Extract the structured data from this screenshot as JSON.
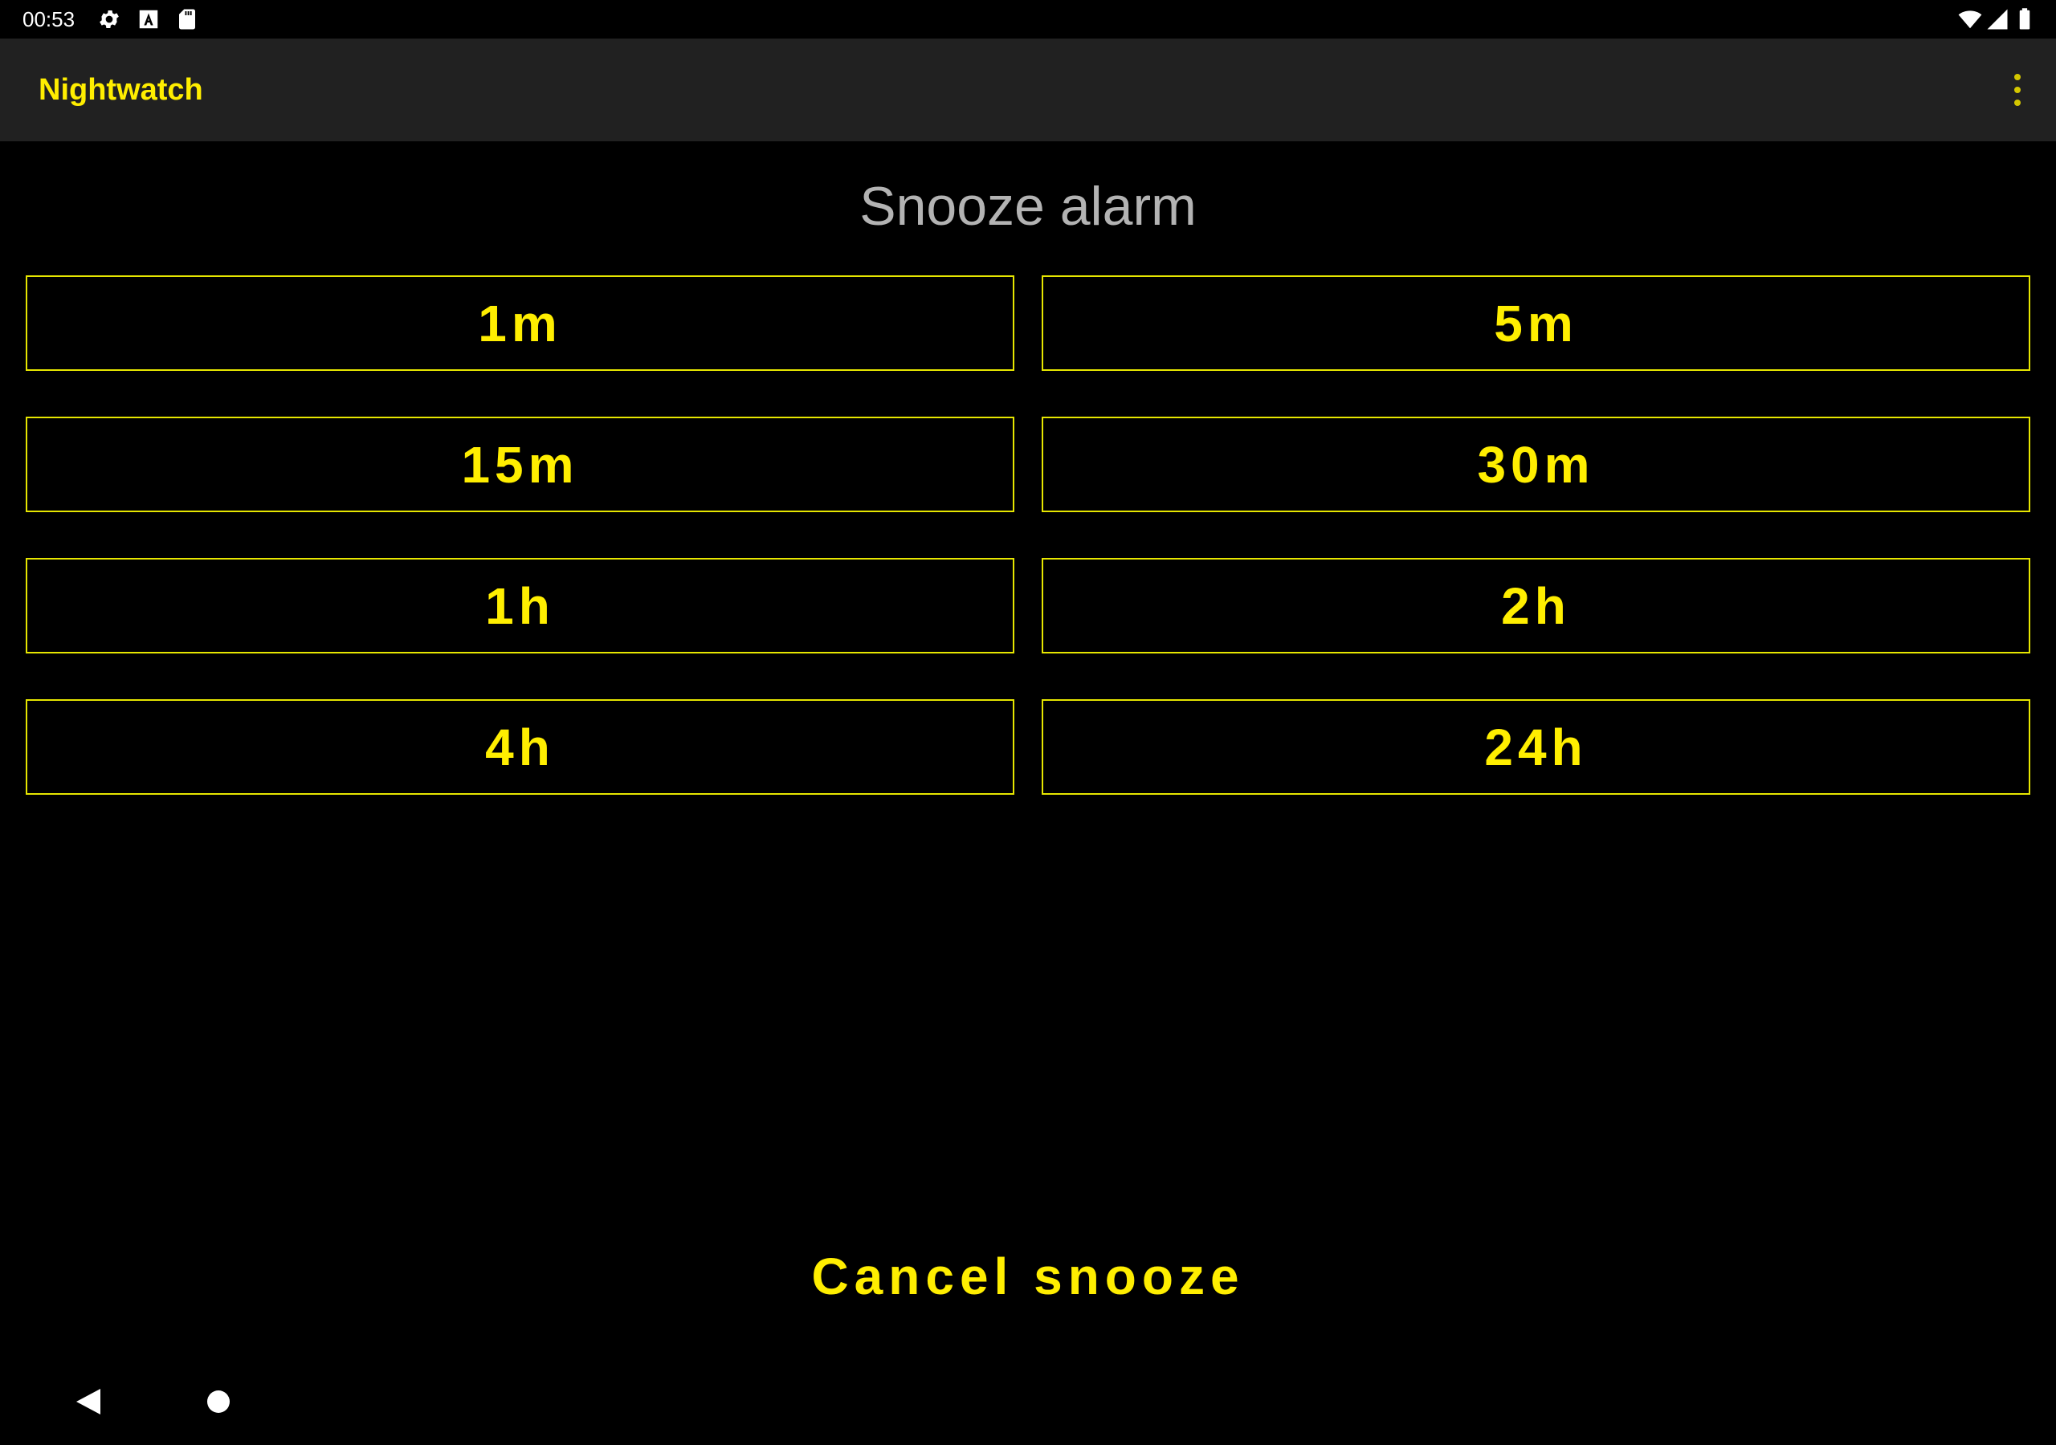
{
  "status_bar": {
    "time": "00:53",
    "icons": [
      "gear-icon",
      "a-keyboard-icon",
      "sd-card-icon",
      "wifi-icon",
      "cell-signal-icon",
      "battery-icon"
    ]
  },
  "app_bar": {
    "title": "Nightwatch",
    "menu_icon": "more-vert-icon"
  },
  "main": {
    "heading": "Snooze alarm",
    "snooze_options": [
      {
        "label": "1m"
      },
      {
        "label": "5m"
      },
      {
        "label": "15m"
      },
      {
        "label": "30m"
      },
      {
        "label": "1h"
      },
      {
        "label": "2h"
      },
      {
        "label": "4h"
      },
      {
        "label": "24h"
      }
    ],
    "cancel_label": "Cancel snooze"
  },
  "nav_bar": {
    "icons": [
      "back-icon",
      "home-icon"
    ]
  },
  "colors": {
    "accent": "#ffee00",
    "button_border": "#e6e600",
    "background": "#000000",
    "app_bar": "#212121",
    "heading_text": "#b3b3b3"
  }
}
